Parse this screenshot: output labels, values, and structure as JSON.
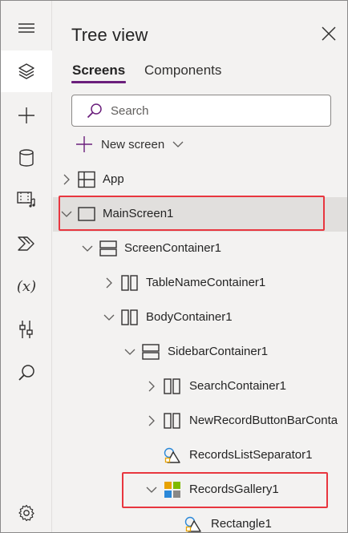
{
  "panel": {
    "title": "Tree view",
    "tabs": [
      {
        "label": "Screens",
        "selected": true
      },
      {
        "label": "Components",
        "selected": false
      }
    ],
    "search_placeholder": "Search",
    "new_screen_label": "New screen"
  },
  "rail": {
    "items": [
      "hamburger-menu-icon",
      "layers-icon",
      "insert-plus-icon",
      "data-cylinder-icon",
      "media-icon",
      "power-automate-icon",
      "variables-icon",
      "advanced-tools-icon",
      "search-icon",
      "settings-icon"
    ],
    "variables_glyph": "(x)",
    "active": "layers-icon"
  },
  "tree": {
    "items": [
      {
        "label": "App",
        "level": 0,
        "chevron": "right",
        "icon": "app-icon"
      },
      {
        "label": "MainScreen1",
        "level": 0,
        "chevron": "down",
        "icon": "screen-icon",
        "selected": true,
        "highlighted": true
      },
      {
        "label": "ScreenContainer1",
        "level": 1,
        "chevron": "down",
        "icon": "vertical-container-icon"
      },
      {
        "label": "TableNameContainer1",
        "level": 2,
        "chevron": "right",
        "icon": "horizontal-container-icon"
      },
      {
        "label": "BodyContainer1",
        "level": 2,
        "chevron": "down",
        "icon": "horizontal-container-icon"
      },
      {
        "label": "SidebarContainer1",
        "level": 3,
        "chevron": "down",
        "icon": "vertical-container-icon"
      },
      {
        "label": "SearchContainer1",
        "level": 4,
        "chevron": "right",
        "icon": "horizontal-container-icon"
      },
      {
        "label": "NewRecordButtonBarConta",
        "level": 4,
        "chevron": "right",
        "icon": "horizontal-container-icon"
      },
      {
        "label": "RecordsListSeparator1",
        "level": 4,
        "chevron": "none",
        "icon": "shape-icon"
      },
      {
        "label": "RecordsGallery1",
        "level": 4,
        "chevron": "down",
        "icon": "gallery-icon",
        "highlighted": true
      },
      {
        "label": "Rectangle1",
        "level": 5,
        "chevron": "none",
        "icon": "shape-icon"
      }
    ]
  },
  "colors": {
    "accent_underline": "#6b1f7c",
    "highlight_border": "#e8363f",
    "selected_row": "#e1dfdd",
    "panel_background": "#f3f2f1"
  }
}
